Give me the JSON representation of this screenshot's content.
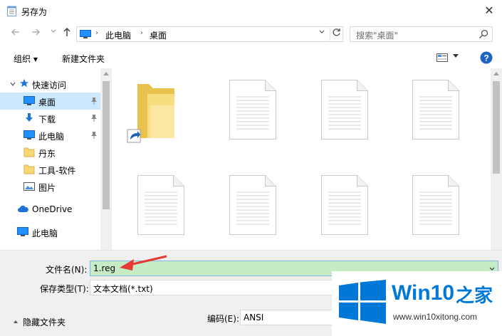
{
  "window": {
    "title": "另存为",
    "close": "✕"
  },
  "address": {
    "crumbs": [
      "此电脑",
      "桌面"
    ],
    "search_placeholder": "搜索\"桌面\""
  },
  "toolbar": {
    "organize": "组织 ▾",
    "new_folder": "新建文件夹"
  },
  "nav": {
    "items": [
      {
        "label": "快速访问",
        "icon": "star-icon"
      },
      {
        "label": "桌面",
        "icon": "desktop-icon",
        "pinned": true,
        "selected": true
      },
      {
        "label": "下载",
        "icon": "download-icon",
        "pinned": true
      },
      {
        "label": "此电脑",
        "icon": "pc-icon",
        "pinned": true
      },
      {
        "label": "丹东",
        "icon": "folder-icon"
      },
      {
        "label": "工具-软件",
        "icon": "folder-icon"
      },
      {
        "label": "图片",
        "icon": "pictures-icon"
      },
      {
        "label": "OneDrive",
        "icon": "cloud-icon"
      },
      {
        "label": "此电脑",
        "icon": "pc-icon"
      }
    ]
  },
  "form": {
    "filename_label": "文件名(N):",
    "filename_value": "1.reg",
    "filetype_label": "保存类型(T):",
    "filetype_value": "文本文档(*.txt)",
    "encoding_label": "编码(E):",
    "encoding_value": "ANSI",
    "hide_folders": "隐藏文件夹"
  },
  "watermark": {
    "brand": "Win10",
    "brand_suffix": "之家",
    "url": "www.win10xitong.com"
  },
  "colors": {
    "selected_bg": "#cce8ff",
    "filename_bg": "#c6ecc6",
    "accent": "#0078d7",
    "arrow": "#e53935"
  }
}
